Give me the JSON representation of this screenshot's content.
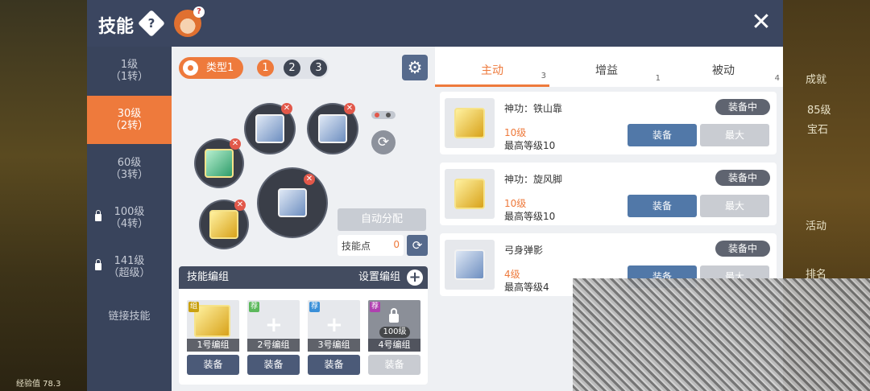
{
  "header": {
    "title": "技能",
    "help_glyph": "?",
    "close_glyph": "✕"
  },
  "nav": {
    "items": [
      {
        "line1": "1级",
        "line2": "（1转）",
        "locked": false,
        "active": false
      },
      {
        "line1": "30级",
        "line2": "（2转）",
        "locked": false,
        "active": true
      },
      {
        "line1": "60级",
        "line2": "（3转）",
        "locked": false,
        "active": false
      },
      {
        "line1": "100级",
        "line2": "（4转）",
        "locked": true,
        "active": false
      },
      {
        "line1": "141级",
        "line2": "（超级）",
        "locked": true,
        "active": false
      },
      {
        "line1": "链接技能",
        "line2": "",
        "locked": false,
        "active": false
      }
    ]
  },
  "preset": {
    "type_label": "类型1",
    "numbers": [
      "1",
      "2",
      "3"
    ],
    "active_number": "1"
  },
  "auto_assign_label": "自动分配",
  "skill_points": {
    "label": "技能点",
    "value": "0"
  },
  "groups": {
    "title": "技能编组",
    "setup_label": "设置编组",
    "slots": [
      {
        "tag": "组",
        "caption": "1号编组",
        "level": "",
        "equip": "装备"
      },
      {
        "tag": "荐",
        "caption": "2号编组",
        "level": "",
        "equip": "装备"
      },
      {
        "tag": "荐",
        "caption": "3号编组",
        "level": "",
        "equip": "装备"
      },
      {
        "tag": "荐",
        "caption": "4号编组",
        "level": "100级",
        "equip": "装备"
      }
    ]
  },
  "tabs": [
    {
      "label": "主动",
      "count": "3"
    },
    {
      "label": "增益",
      "count": "1"
    },
    {
      "label": "被动",
      "count": "4"
    }
  ],
  "skills": [
    {
      "name": "神功：铁山靠",
      "level": "10级",
      "max": "最高等级10",
      "status": "装备中",
      "equip": "装备",
      "max_btn": "最大"
    },
    {
      "name": "神功：旋风脚",
      "level": "10级",
      "max": "最高等级10",
      "status": "装备中",
      "equip": "装备",
      "max_btn": "最大"
    },
    {
      "name": "弓身弹影",
      "level": "4级",
      "max": "最高等级4",
      "status": "装备中",
      "equip": "装备",
      "max_btn": "最大"
    }
  ],
  "background_side": {
    "right_labels": [
      "成就",
      "85级",
      "宝石",
      "活动",
      "排名"
    ],
    "left_label": "经验值 78.3"
  },
  "colors": {
    "accent": "#ee7a3c",
    "header": "#3b4660",
    "equip": "#5178a8"
  }
}
